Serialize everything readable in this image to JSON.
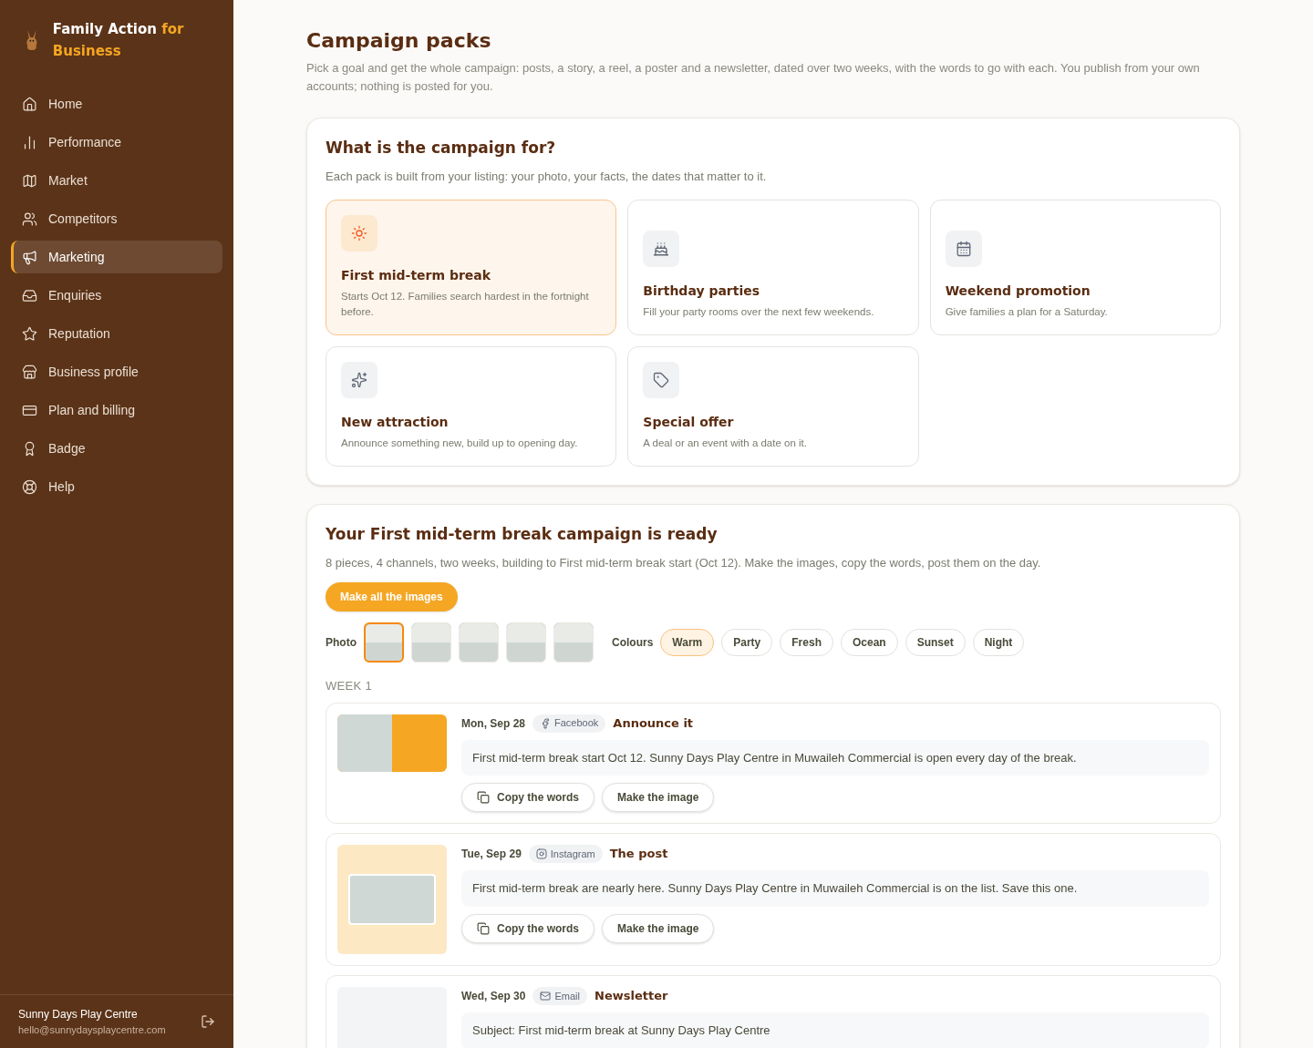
{
  "brand": {
    "name": "Family Action",
    "highlight": "for Business"
  },
  "nav": [
    {
      "label": "Home",
      "kind": "home",
      "selected": false
    },
    {
      "label": "Performance",
      "kind": "chart",
      "selected": false
    },
    {
      "label": "Market",
      "kind": "map",
      "selected": false
    },
    {
      "label": "Competitors",
      "kind": "users",
      "selected": false
    },
    {
      "label": "Marketing",
      "kind": "megaphone",
      "selected": true
    },
    {
      "label": "Enquiries",
      "kind": "inbox",
      "selected": false
    },
    {
      "label": "Reputation",
      "kind": "star",
      "selected": false
    },
    {
      "label": "Business profile",
      "kind": "store",
      "selected": false
    },
    {
      "label": "Plan and billing",
      "kind": "card",
      "selected": false
    },
    {
      "label": "Badge",
      "kind": "award",
      "selected": false
    },
    {
      "label": "Help",
      "kind": "help",
      "selected": false
    }
  ],
  "account": {
    "name": "Sunny Days Play Centre",
    "email": "hello@sunnydaysplaycentre.com"
  },
  "page": {
    "title": "Campaign packs",
    "subtitle": "Pick a goal and get the whole campaign: posts, a story, a reel, a poster and a newsletter, dated over two weeks, with the words to go with each. You publish from your own accounts; nothing is posted for you."
  },
  "goals": {
    "title": "What is the campaign for?",
    "subtitle": "Each pack is built from your listing: your photo, your facts, the dates that matter to it.",
    "items": [
      {
        "kind": "sun",
        "title": "First mid-term break",
        "text": "Starts Oct 12. Families search hardest in the fortnight before.",
        "selected": true
      },
      {
        "kind": "cake",
        "title": "Birthday parties",
        "text": "Fill your party rooms over the next few weekends.",
        "selected": false
      },
      {
        "kind": "calendar",
        "title": "Weekend promotion",
        "text": "Give families a plan for a Saturday.",
        "selected": false
      },
      {
        "kind": "sparkles",
        "title": "New attraction",
        "text": "Announce something new, build up to opening day.",
        "selected": false
      },
      {
        "kind": "tag",
        "title": "Special offer",
        "text": "A deal or an event with a date on it.",
        "selected": false
      }
    ]
  },
  "campaign": {
    "title": "Your First mid-term break campaign is ready",
    "subtitle": "8 pieces, 4 channels, two weeks, building to First mid-term break start (Oct 12). Make the images, copy the words, post them on the day.",
    "make_all": "Make all the images",
    "photo_label": "Photo",
    "photos": [
      {
        "selected": true
      },
      {
        "selected": false
      },
      {
        "selected": false
      },
      {
        "selected": false
      },
      {
        "selected": false
      }
    ],
    "colours_label": "Colours",
    "colours": [
      {
        "label": "Warm",
        "selected": true
      },
      {
        "label": "Party",
        "selected": false
      },
      {
        "label": "Fresh",
        "selected": false
      },
      {
        "label": "Ocean",
        "selected": false
      },
      {
        "label": "Sunset",
        "selected": false
      },
      {
        "label": "Night",
        "selected": false
      }
    ],
    "week": "WEEK 1",
    "pieces": [
      {
        "date": "Mon, Sep 28",
        "channel": "Facebook",
        "kind": "facebook",
        "title": "Announce it",
        "text": "First mid-term break start Oct 12. Sunny Days Play Centre in Muwaileh Commercial is open every day of the break.",
        "actions": [
          "Copy the words",
          "Make the image"
        ]
      },
      {
        "date": "Tue, Sep 29",
        "channel": "Instagram",
        "kind": "instagram",
        "title": "The post",
        "text": "First mid-term break are nearly here. Sunny Days Play Centre in Muwaileh Commercial is on the list. Save this one.",
        "actions": [
          "Copy the words",
          "Make the image"
        ]
      },
      {
        "date": "Wed, Sep 30",
        "channel": "Email",
        "kind": "email",
        "title": "Newsletter",
        "text": "Subject: First mid-term break at Sunny Days Play Centre"
      }
    ]
  }
}
